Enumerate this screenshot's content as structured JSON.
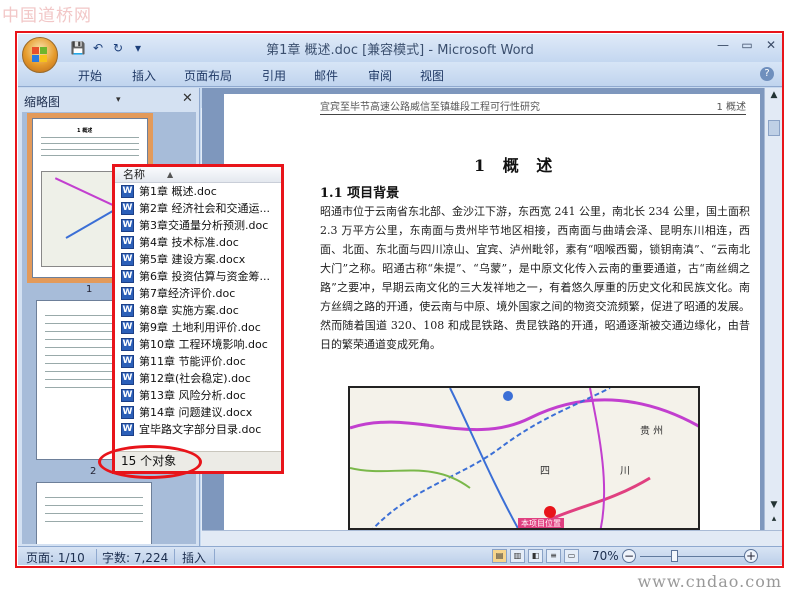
{
  "watermarks": {
    "top": "中国道桥网",
    "bottom": "www.cndao.com"
  },
  "window": {
    "title": "第1章 概述.doc [兼容模式] - Microsoft Word",
    "controls": {
      "minimize": "—",
      "restore": "▭",
      "close": "✕"
    }
  },
  "quick_access": {
    "save_icon": "💾",
    "undo_icon": "↶",
    "redo_icon": "↻",
    "customize_icon": "▾"
  },
  "ribbon_tabs": [
    "开始",
    "插入",
    "页面布局",
    "引用",
    "邮件",
    "审阅",
    "视图"
  ],
  "help": "?",
  "thumbnail_pane": {
    "title": "缩略图",
    "dropdown": "▾",
    "close": "✕",
    "pages": [
      "1",
      "2"
    ],
    "page1_heading": "1 概述"
  },
  "document": {
    "header_text": "宜宾至毕节高速公路威信至镇雄段工程可行性研究",
    "header_right": "1 概述",
    "chapter_title": "1 概 述",
    "section_title": "1.1 项目背景",
    "paragraph": "昭通市位于云南省东北部、金沙江下游，东西宽 241 公里，南北长 234 公里，国土面积 2.3 万平方公里，东南面与贵州毕节地区相接，西南面与曲靖会泽、昆明东川相连，西面、北面、东北面与四川凉山、宜宾、泸州毗邻，素有“咽喉西蜀，锁钥南滇”、“云南北大门”之称。昭通古称“朱提”、“乌蒙”，是中原文化传入云南的重要通道，古“南丝绸之路”之要冲，早期云南文化的三大发祥地之一，有着悠久厚重的历史文化和民族文化。南方丝绸之路的开通，使云南与中原、境外国家之间的物资交流频繁，促进了昭通的发展。然而随着国道 320、108 和成昆铁路、贵昆铁路的开通，昭通逐渐被交通边缘化，由昔日的繁荣通道变成死角。",
    "map": {
      "region1": "四",
      "region2": "川",
      "region3": "贵  州",
      "project_label": "本项目位置"
    }
  },
  "file_list": {
    "header": "名称",
    "sort_icon": "▲",
    "icon_letter": "W",
    "files": [
      "第1章 概述.doc",
      "第2章 经济社会和交通运...",
      "第3章交通量分析预测.doc",
      "第4章 技术标准.doc",
      "第5章 建设方案.docx",
      "第6章 投资估算与资金筹...",
      "第7章经济评价.doc",
      "第8章 实施方案.doc",
      "第9章 土地利用评价.doc",
      "第10章 工程环境影响.doc",
      "第11章  节能评价.doc",
      "第12章(社会稳定).doc",
      "第13章 风险分析.doc",
      "第14章 问题建议.docx",
      "宜毕路文字部分目录.doc"
    ],
    "status": "15 个对象"
  },
  "statusbar": {
    "page": "页面: 1/10",
    "words": "字数: 7,224",
    "mode": "插入",
    "zoom": "70%",
    "zoom_level": 0.7
  },
  "colors": {
    "highlight": "#e8141a",
    "ribbon": "#c7d9ef",
    "selected_thumb": "#e39a5a"
  }
}
